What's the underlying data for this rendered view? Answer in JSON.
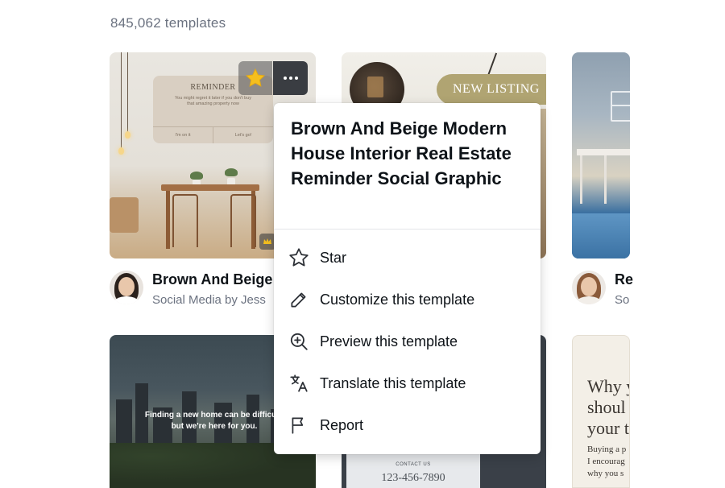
{
  "results": {
    "count_label": "845,062 templates"
  },
  "colors": {
    "star": "#f5bf1e",
    "text_primary": "#0e1318",
    "text_secondary": "#6b7280",
    "menu_bg": "#ffffff"
  },
  "cards": [
    {
      "preview": {
        "heading": "REMINDER",
        "body": "You might regret it later if you don't buy that amazing property now",
        "button_left": "I'm on it",
        "button_right": "Let's go!"
      },
      "title": "Brown And Beige",
      "subtitle": "Social Media by Jess"
    },
    {
      "preview": {
        "badge": "NEW LISTING"
      },
      "title": "",
      "subtitle": ""
    },
    {
      "title": "Re",
      "subtitle": "So"
    },
    {
      "preview": {
        "text": "Finding a new home can be difficult, but we're here for you."
      }
    },
    {
      "preview": {
        "contact_label": "CONTACT US",
        "phone": "123-456-7890"
      }
    },
    {
      "preview": {
        "heading_lines": [
          "Why y",
          "shoul",
          "your t"
        ],
        "body_lines": [
          "Buying a p",
          "I encourag",
          "why you s"
        ]
      }
    }
  ],
  "context_menu": {
    "title": "Brown And Beige Modern House Interior Real Estate Reminder Social Graphic",
    "items": [
      {
        "label": "Star",
        "icon": "star-outline-icon"
      },
      {
        "label": "Customize this template",
        "icon": "pencil-icon"
      },
      {
        "label": "Preview this template",
        "icon": "zoom-in-icon"
      },
      {
        "label": "Translate this template",
        "icon": "translate-icon"
      },
      {
        "label": "Report",
        "icon": "flag-icon"
      }
    ]
  }
}
